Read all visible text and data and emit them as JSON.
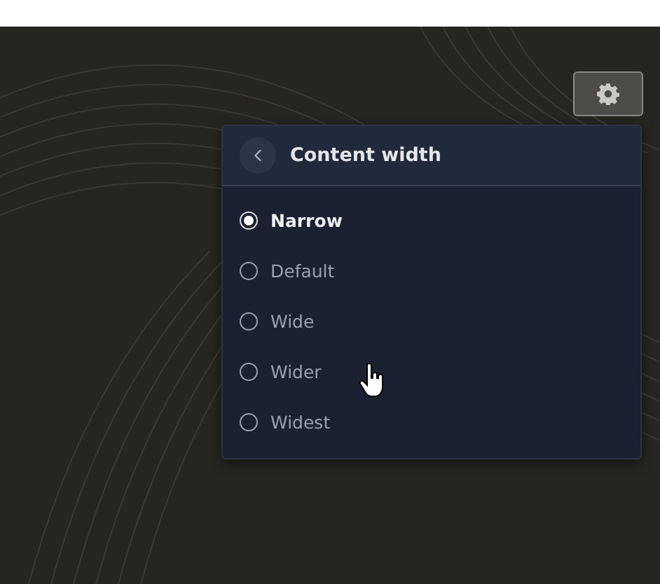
{
  "settings_button": {
    "kind": "gear"
  },
  "menu": {
    "title": "Content width",
    "options": [
      {
        "label": "Narrow",
        "selected": true
      },
      {
        "label": "Default",
        "selected": false
      },
      {
        "label": "Wide",
        "selected": false
      },
      {
        "label": "Wider",
        "selected": false
      },
      {
        "label": "Widest",
        "selected": false
      }
    ]
  }
}
